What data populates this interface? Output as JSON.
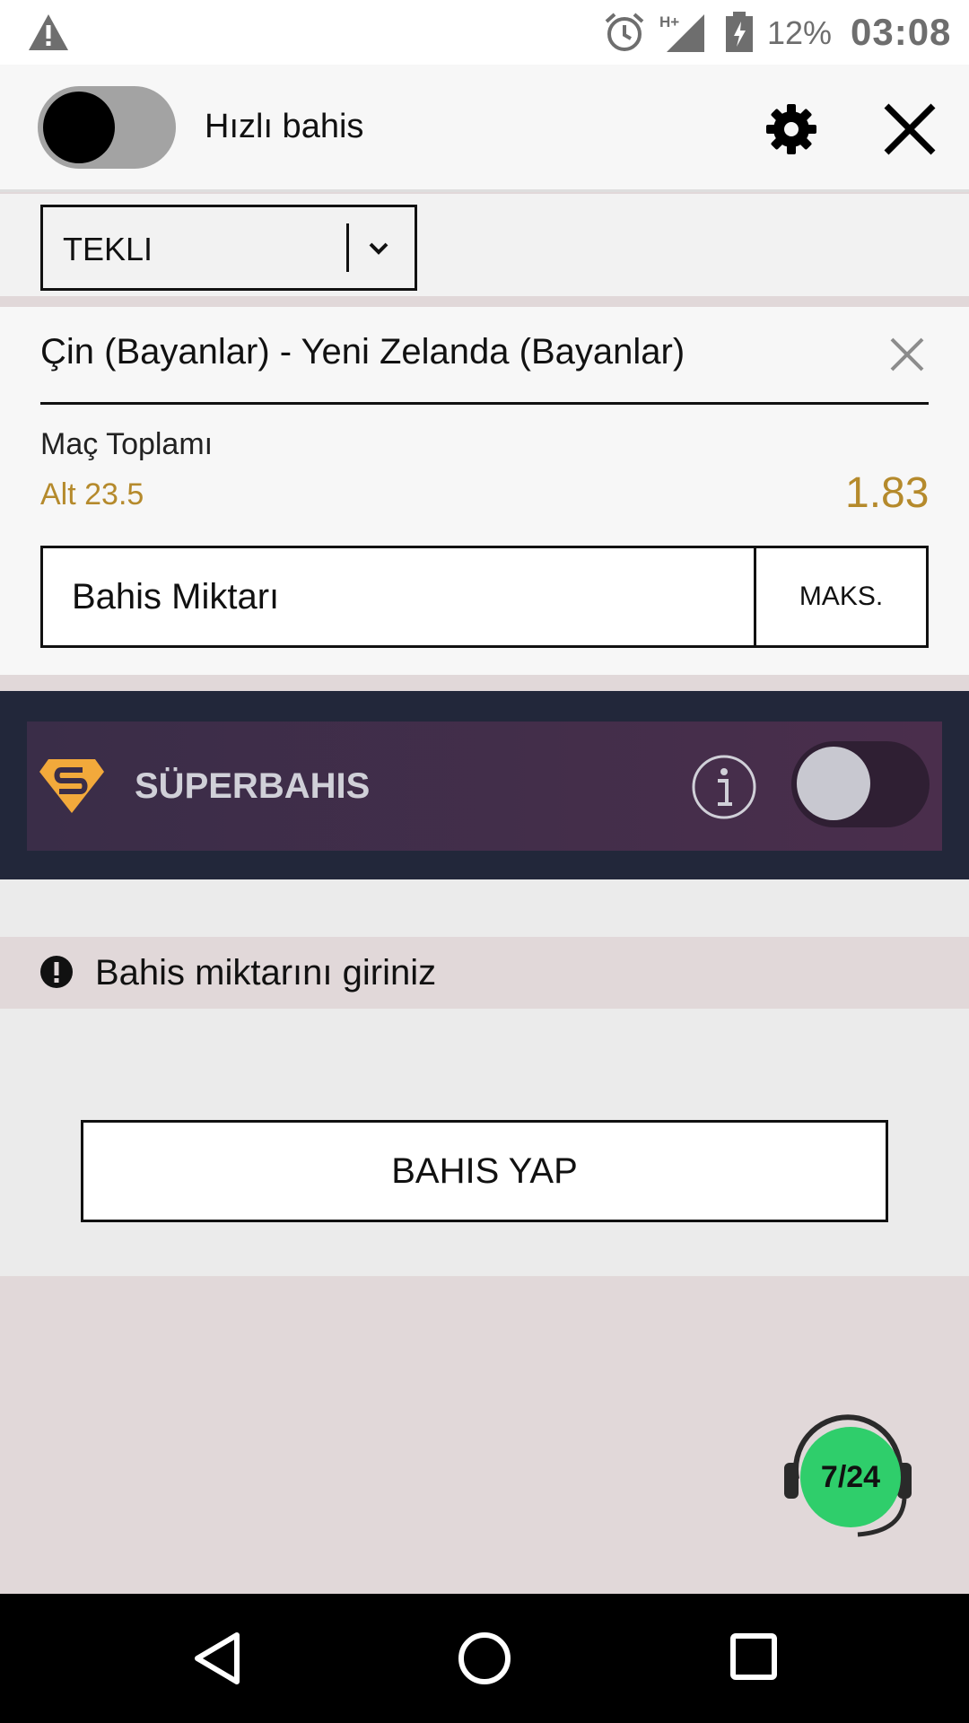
{
  "status_bar": {
    "battery_percent": "12%",
    "time": "03:08",
    "network": "H+",
    "icons": [
      "warning-icon",
      "alarm-icon",
      "signal-icon",
      "battery-icon"
    ]
  },
  "header": {
    "quick_bet_label": "Hızlı bahis",
    "quick_bet_enabled": false,
    "icons": [
      "gear-icon",
      "close-icon"
    ]
  },
  "bet_type": {
    "selected": "TEKLI"
  },
  "selection": {
    "match": "Çin (Bayanlar) - Yeni Zelanda (Bayanlar)",
    "market": "Maç Toplamı",
    "outcome": "Alt 23.5",
    "odds": "1.83"
  },
  "stake": {
    "placeholder": "Bahis Miktarı",
    "value": "",
    "max_label": "MAKS."
  },
  "superbet": {
    "title": "SÜPERBAHIS",
    "enabled": false
  },
  "warning": {
    "text": "Bahis miktarını giriniz"
  },
  "actions": {
    "place_bet_label": "BAHIS YAP"
  },
  "support": {
    "badge": "7/24"
  },
  "colors": {
    "accent_gold": "#b58a2c",
    "superbet_bg": "#22273a",
    "support_green": "#2fce6b"
  }
}
